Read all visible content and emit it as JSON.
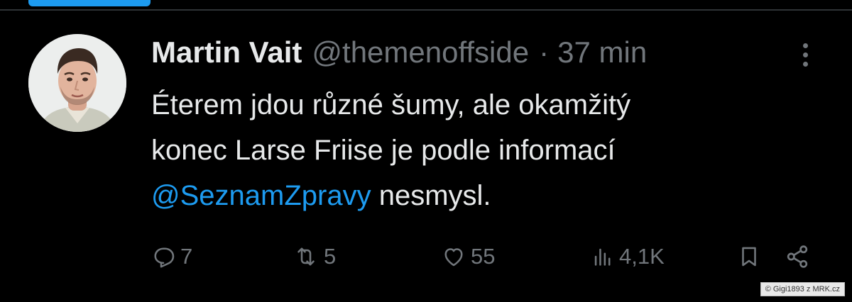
{
  "tweet": {
    "display_name": "Martin Vait",
    "handle": "@themenoffside",
    "separator": "·",
    "time": "37 min",
    "text_line1": "Éterem jdou různé šumy, ale okamžitý",
    "text_line2": "konec Larse Friise je podle informací",
    "mention": "@SeznamZpravy",
    "text_after_mention": " nesmysl."
  },
  "actions": {
    "reply_count": "7",
    "retweet_count": "5",
    "like_count": "55",
    "views_count": "4,1K"
  },
  "icons": {
    "more": "more-vertical-icon",
    "reply": "reply-icon",
    "retweet": "retweet-icon",
    "like": "heart-icon",
    "views": "views-bar-chart-icon",
    "bookmark": "bookmark-icon",
    "share": "share-icon"
  },
  "credit": "© Gigi1893 z MRK.cz",
  "colors": {
    "background": "#000000",
    "text": "#e7e9ea",
    "muted": "#71767b",
    "accent": "#1d9bf0"
  }
}
